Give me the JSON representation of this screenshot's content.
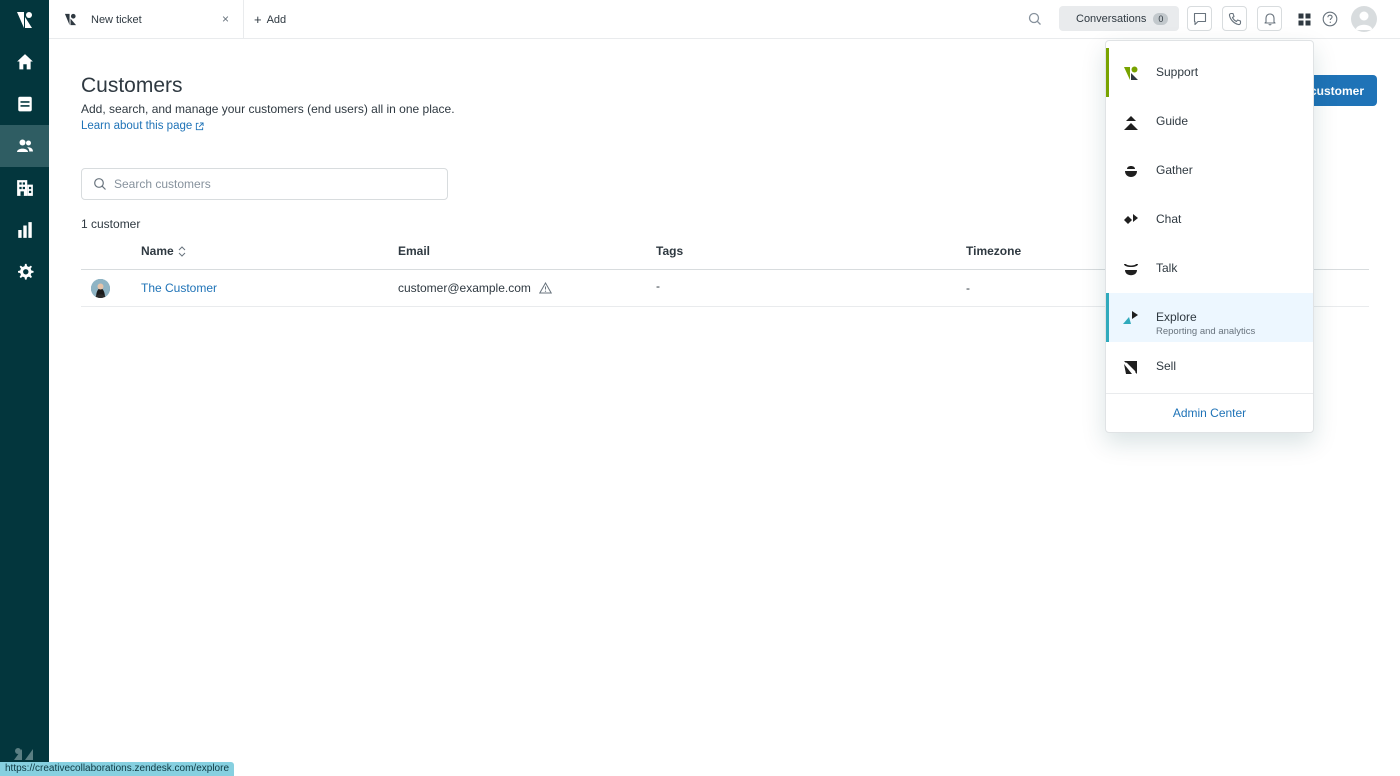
{
  "topbar": {
    "tab_label": "New ticket",
    "tab_close": "×",
    "add_label": "Add",
    "conversations_label": "Conversations",
    "conversations_count": "0"
  },
  "page": {
    "title": "Customers",
    "description": "Add, search, and manage your customers (end users) all in one place.",
    "learn_link": "Learn about this page",
    "add_button": "customer",
    "search_placeholder": "Search customers",
    "count_label": "1 customer"
  },
  "table": {
    "headers": {
      "name": "Name",
      "email": "Email",
      "tags": "Tags",
      "timezone": "Timezone"
    },
    "rows": [
      {
        "name": "The Customer",
        "email": "customer@example.com",
        "tags": "-",
        "timezone": "-"
      }
    ]
  },
  "product_menu": {
    "items": [
      {
        "label": "Support",
        "sublabel": ""
      },
      {
        "label": "Guide",
        "sublabel": ""
      },
      {
        "label": "Gather",
        "sublabel": ""
      },
      {
        "label": "Chat",
        "sublabel": ""
      },
      {
        "label": "Talk",
        "sublabel": ""
      },
      {
        "label": "Explore",
        "sublabel": "Reporting and analytics"
      },
      {
        "label": "Sell",
        "sublabel": ""
      }
    ],
    "admin_center": "Admin Center"
  },
  "statusbar": {
    "url": "https://creativecollaborations.zendesk.com/explore"
  },
  "colors": {
    "nav_bg": "#03363d",
    "nav_active": "#2f5d63",
    "primary": "#1f73b7",
    "support_green": "#78a300",
    "explore_teal": "#30aabc"
  }
}
